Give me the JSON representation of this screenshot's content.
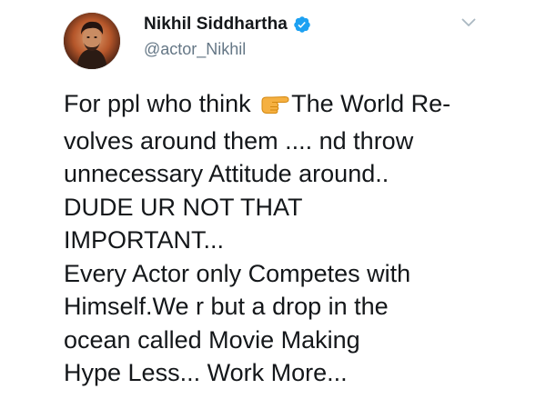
{
  "user": {
    "display_name": "Nikhil Siddhartha",
    "handle": "@actor_Nikhil",
    "verified": true
  },
  "icons": {
    "verified": "verified-badge-icon",
    "menu": "chevron-down-icon",
    "pointing": "backhand-index-pointing-right-icon"
  },
  "colors": {
    "verified_badge": "#1da1f2",
    "handle": "#657786",
    "text": "#14171a",
    "chevron": "#aab8c2",
    "pointing_hand": "#f5b041"
  },
  "tweet": {
    "line1_a": "For ppl who think ",
    "line1_b": "The World Re-",
    "line2": "volves around them .... nd throw",
    "line3": "unnecessary Attitude around..",
    "line4": "DUDE UR NOT THAT",
    "line5": "IMPORTANT...",
    "line6": "Every Actor only Competes with",
    "line7": "Himself.We r but a drop in the",
    "line8": "ocean called Movie Making",
    "line9": "Hype Less... Work More..."
  }
}
